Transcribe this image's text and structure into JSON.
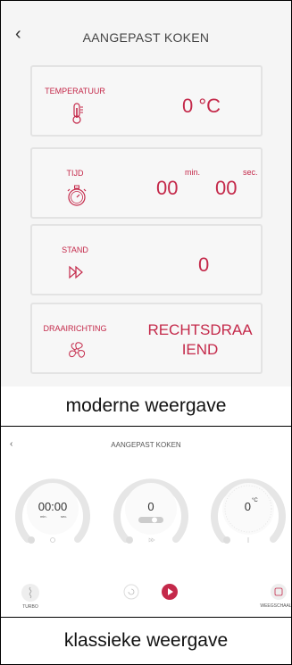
{
  "modern_view": {
    "header": {
      "title": "AANGEPAST KOKEN",
      "back_icon": "chevron-left-icon"
    },
    "cards": {
      "temperature": {
        "label": "TEMPERATUUR",
        "value": "0 °C",
        "icon": "thermometer-icon"
      },
      "time": {
        "label": "TIJD",
        "minutes": "00",
        "seconds": "00",
        "min_label": "min.",
        "sec_label": "sec.",
        "icon": "stopwatch-icon"
      },
      "speed": {
        "label": "STAND",
        "value": "0",
        "icon": "fast-forward-icon"
      },
      "direction": {
        "label": "DRAAIRICHTING",
        "value_line1": "RECHTSDRAA",
        "value_line2": "IEND",
        "icon": "fan-icon"
      }
    },
    "caption": "moderne weergave"
  },
  "classic_view": {
    "header": {
      "title": "AANGEPAST KOKEN",
      "back_icon": "chevron-left-icon"
    },
    "dials": {
      "time": {
        "value": "00:00",
        "min_label": "min.",
        "sec_label": "sec."
      },
      "speed": {
        "value": "0"
      },
      "temperature": {
        "value": "0",
        "unit": "°C"
      }
    },
    "bottom": {
      "turbo_label": "TURBO",
      "scale_label": "WEEGSCHAAL"
    },
    "caption": "klassieke weergave"
  },
  "colors": {
    "accent": "#c4294a",
    "background": "#f5f5f5"
  }
}
